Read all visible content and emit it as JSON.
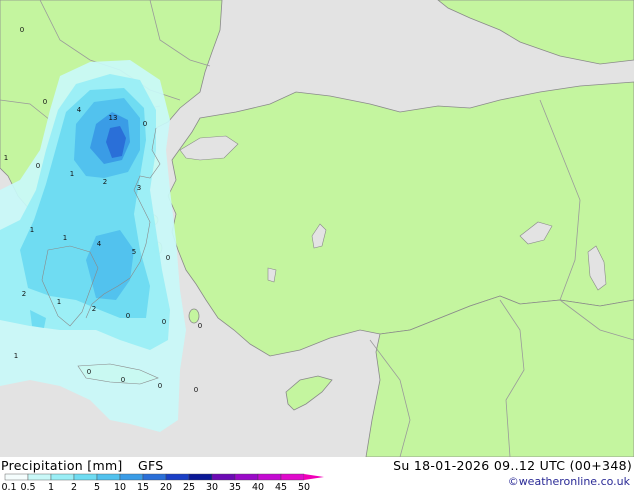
{
  "map": {
    "colors": {
      "sea": "#e3e3e3",
      "land": "#c4f59f",
      "border": "#9a9a9a",
      "coast": "#8a8a8a"
    },
    "contour_labels": [
      "0",
      "0",
      "4",
      "13",
      "0",
      "1",
      "0",
      "1",
      "2",
      "3",
      "1",
      "1",
      "4",
      "5",
      "0",
      "2",
      "1",
      "2",
      "0",
      "0",
      "0",
      "1",
      "0",
      "0"
    ]
  },
  "bottom_bar": {
    "title": "Precipitation [mm]",
    "model": "GFS",
    "valid_time": "Su 18-01-2026 09..12 UTC (00+348)",
    "credit": "©weatheronline.co.uk"
  },
  "legend": {
    "ticks": [
      "0.1",
      "0.5",
      "1",
      "2",
      "5",
      "10",
      "15",
      "20",
      "25",
      "30",
      "35",
      "40",
      "45",
      "50"
    ],
    "colors": [
      "#f5fdfd",
      "#c9f8f8",
      "#9aeef6",
      "#6fdcf2",
      "#52c2ee",
      "#3a9ce6",
      "#2a6fd8",
      "#1a3fc6",
      "#0a1896",
      "#6c0ab4",
      "#9a0ac8",
      "#c40ad2",
      "#e00acc",
      "#f000b8"
    ]
  }
}
